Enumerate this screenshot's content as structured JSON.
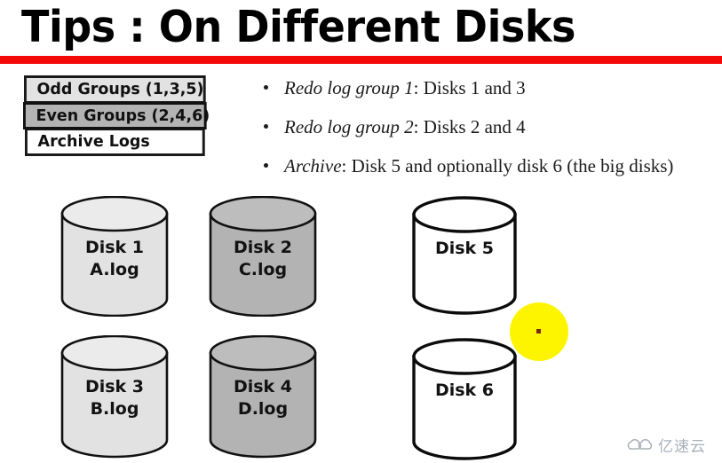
{
  "slide": {
    "title": "Tips : On Different Disks",
    "accent_rule_color": "#f50808",
    "background": "#ffffff"
  },
  "legend": {
    "rows": [
      {
        "label": "Odd Groups (1,3,5)",
        "fill": "#e2e2e2"
      },
      {
        "label": "Even Groups (2,4,6)",
        "fill": "#b3b3b3"
      },
      {
        "label": "Archive Logs",
        "fill": "#ffffff"
      }
    ]
  },
  "bullets": [
    {
      "emphasis": "Redo log group 1",
      "rest": ": Disks 1 and 3"
    },
    {
      "emphasis": "Redo log group 2",
      "rest": ": Disks 2 and 4"
    },
    {
      "emphasis": "Archive",
      "rest": ": Disk 5 and optionally disk 6 (the big disks)"
    }
  ],
  "disks": [
    {
      "name": "Disk 1",
      "file": "A.log",
      "fill": "#e2e2e2"
    },
    {
      "name": "Disk 2",
      "file": "C.log",
      "fill": "#b3b3b3"
    },
    {
      "name": "Disk 5",
      "file": "",
      "fill": "#ffffff"
    },
    {
      "name": "Disk 3",
      "file": "B.log",
      "fill": "#e2e2e2"
    },
    {
      "name": "Disk 4",
      "file": "D.log",
      "fill": "#b3b3b3"
    },
    {
      "name": "Disk 6",
      "file": "",
      "fill": "#ffffff"
    }
  ],
  "cursor": {
    "highlight_color": "#fdf500",
    "dot_color": "#7a2b16"
  },
  "watermark": {
    "text": "亿速云",
    "color": "#9aa3b0"
  }
}
